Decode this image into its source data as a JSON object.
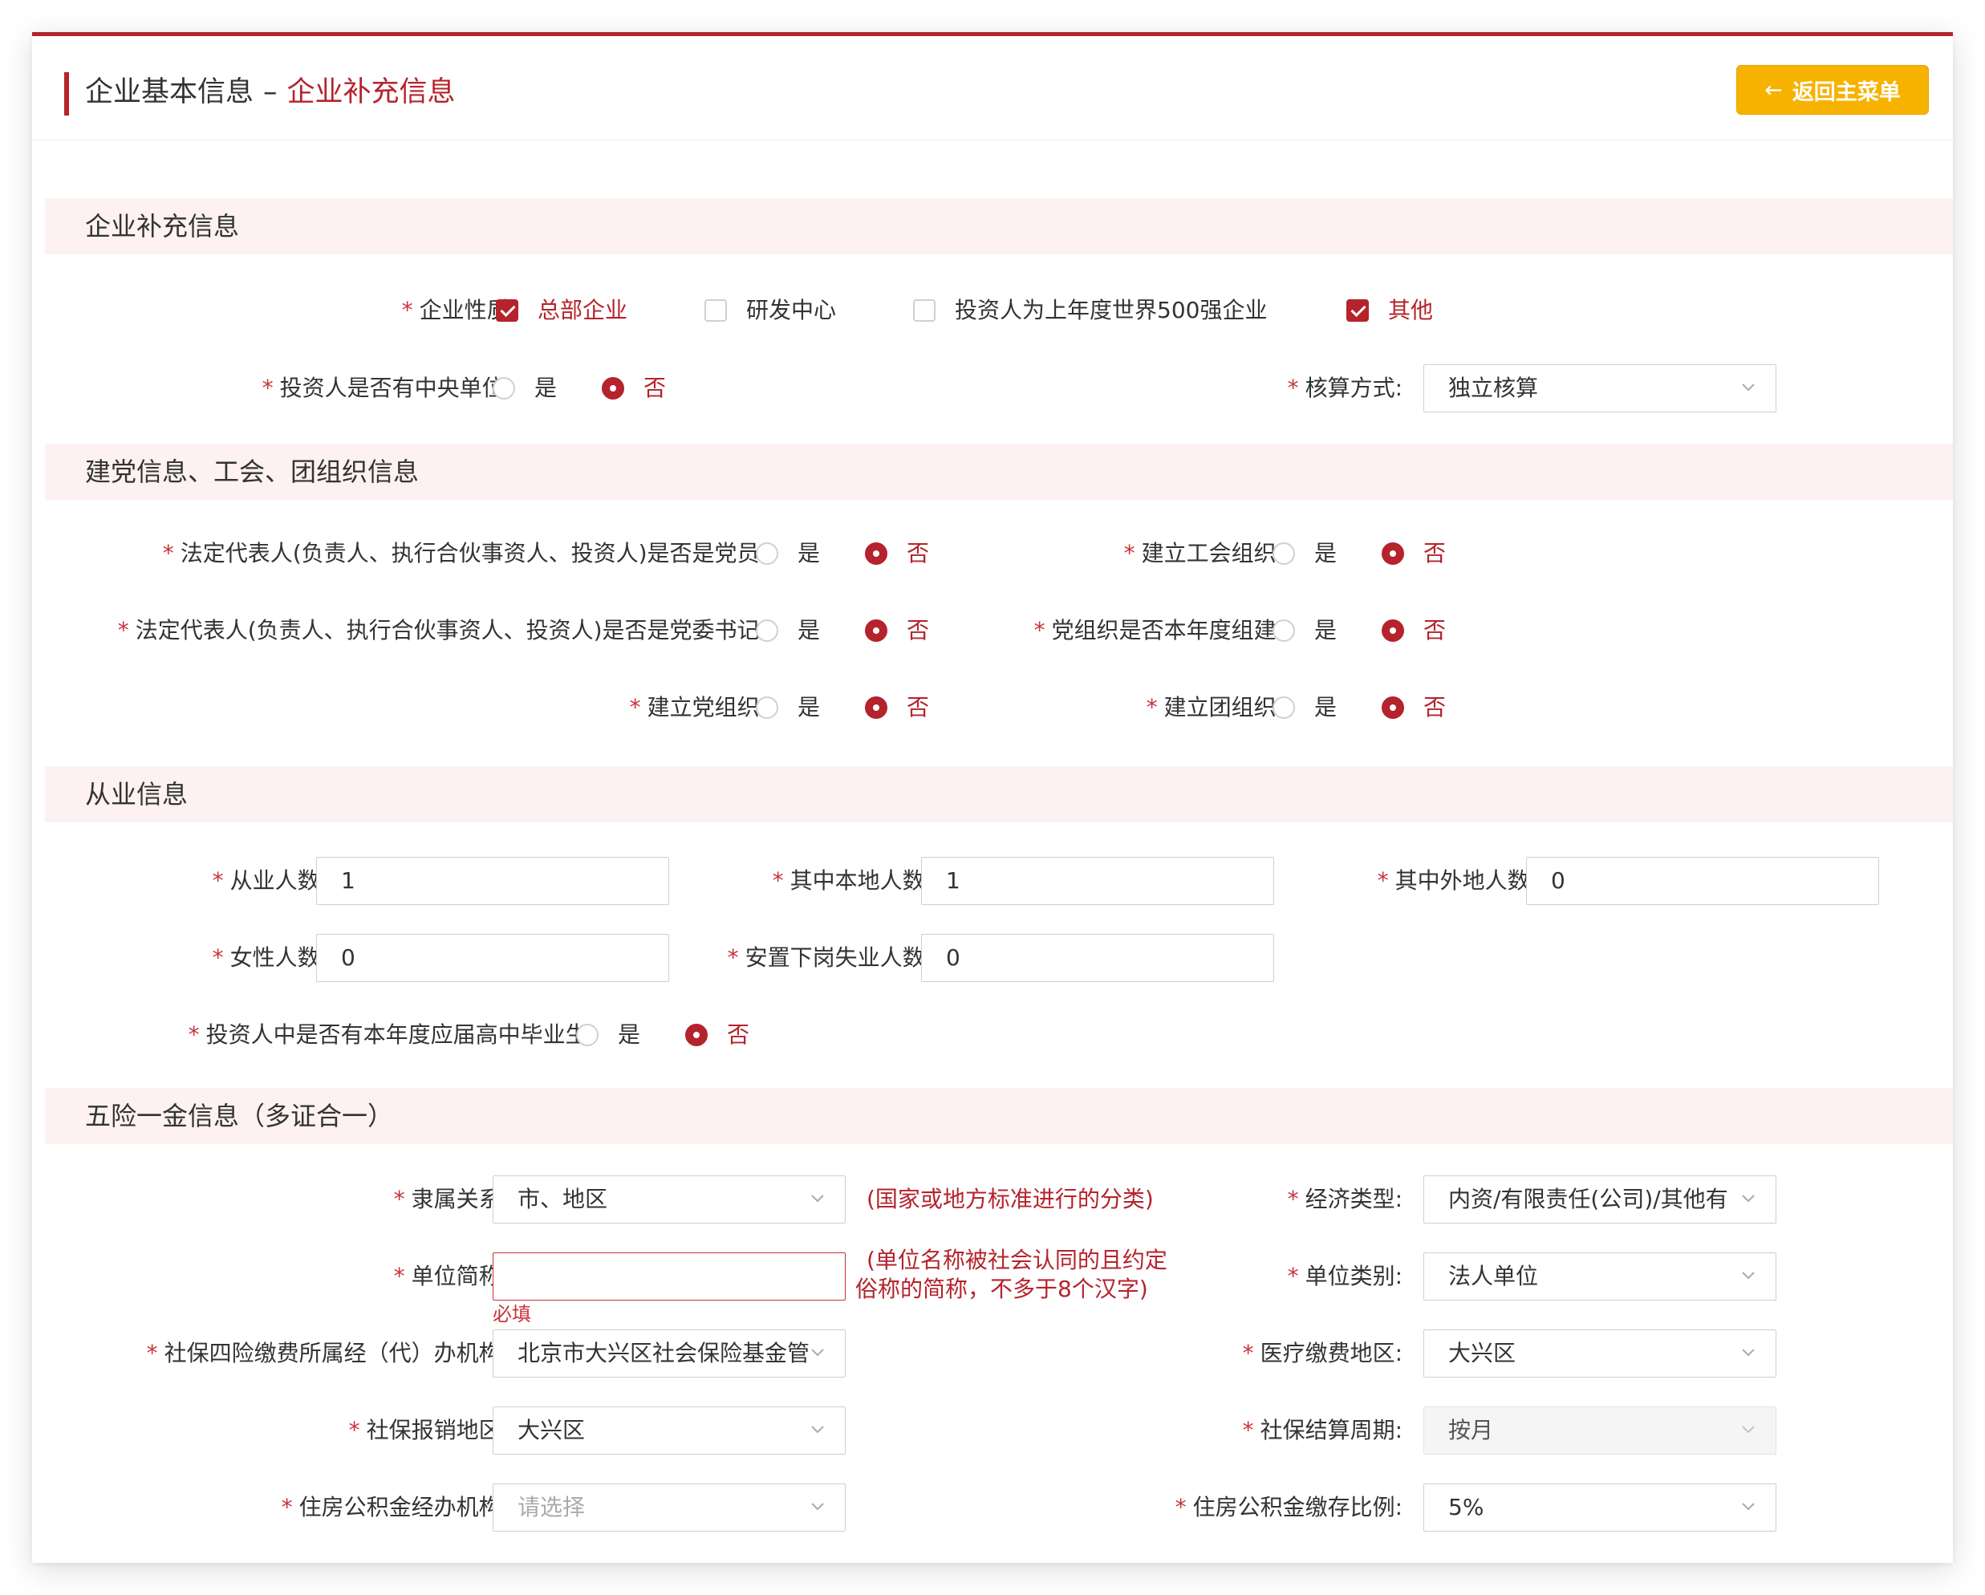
{
  "header": {
    "title_main": "企业基本信息",
    "title_sep": "–",
    "title_sub": "企业补充信息",
    "back_button_icon": "arrow-left-icon",
    "back_button_label": "返回主菜单"
  },
  "colors": {
    "accent": "#b5232c",
    "button": "#f7b200",
    "section_bg": "#fdf1f1"
  },
  "required_mark": "*",
  "radio_labels": {
    "yes": "是",
    "no": "否"
  },
  "sections": {
    "supplement": "企业补充信息",
    "party": "建党信息、工会、团组织信息",
    "employment": "从业信息",
    "insurance": "五险一金信息（多证合一）"
  },
  "supplement": {
    "nature_label": "企业性质:",
    "nature_options": [
      {
        "label": "总部企业",
        "checked": true
      },
      {
        "label": "研发中心",
        "checked": false
      },
      {
        "label": "投资人为上年度世界500强企业",
        "checked": false
      },
      {
        "label": "其他",
        "checked": true
      }
    ],
    "central_unit_label": "投资人是否有中央单位:",
    "central_unit_value": "否",
    "accounting_label": "核算方式:",
    "accounting_value": "独立核算"
  },
  "party": {
    "legal_rep_party_member_label": "法定代表人(负责人、执行合伙事资人、投资人)是否是党员:",
    "legal_rep_party_member_value": "否",
    "union_label": "建立工会组织:",
    "union_value": "否",
    "legal_rep_secretary_label": "法定代表人(负责人、执行合伙事资人、投资人)是否是党委书记:",
    "legal_rep_secretary_value": "否",
    "party_org_this_year_label": "党组织是否本年度组建:",
    "party_org_this_year_value": "否",
    "party_org_label": "建立党组织:",
    "party_org_value": "否",
    "youth_org_label": "建立团组织:",
    "youth_org_value": "否"
  },
  "employment": {
    "employees_label": "从业人数:",
    "employees_value": "1",
    "local_label": "其中本地人数:",
    "local_value": "1",
    "nonlocal_label": "其中外地人数:",
    "nonlocal_value": "0",
    "female_label": "女性人数:",
    "female_value": "0",
    "laid_off_label": "安置下岗失业人数:",
    "laid_off_value": "0",
    "graduate_label": "投资人中是否有本年度应届高中毕业生:",
    "graduate_value": "否"
  },
  "insurance": {
    "affiliation_label": "隶属关系:",
    "affiliation_value": "市、地区",
    "affiliation_hint": "(国家或地方标准进行的分类)",
    "economic_type_label": "经济类型:",
    "economic_type_value": "内资/有限责任(公司)/其他有",
    "short_name_label": "单位简称:",
    "short_name_value": "",
    "short_name_error": "必填",
    "short_name_hint_line1": "(单位名称被社会认同的且约定",
    "short_name_hint_line2": "俗称的简称，不多于8个汉字)",
    "unit_category_label": "单位类别:",
    "unit_category_value": "法人单位",
    "agency_label": "社保四险缴费所属经（代）办机构:",
    "agency_value": "北京市大兴区社会保险基金管",
    "medical_area_label": "医疗缴费地区:",
    "medical_area_value": "大兴区",
    "reimburse_area_label": "社保报销地区:",
    "reimburse_area_value": "大兴区",
    "settlement_cycle_label": "社保结算周期:",
    "settlement_cycle_value": "按月",
    "fund_agency_label": "住房公积金经办机构:",
    "fund_agency_placeholder": "请选择",
    "fund_ratio_label": "住房公积金缴存比例:",
    "fund_ratio_value": "5%"
  }
}
